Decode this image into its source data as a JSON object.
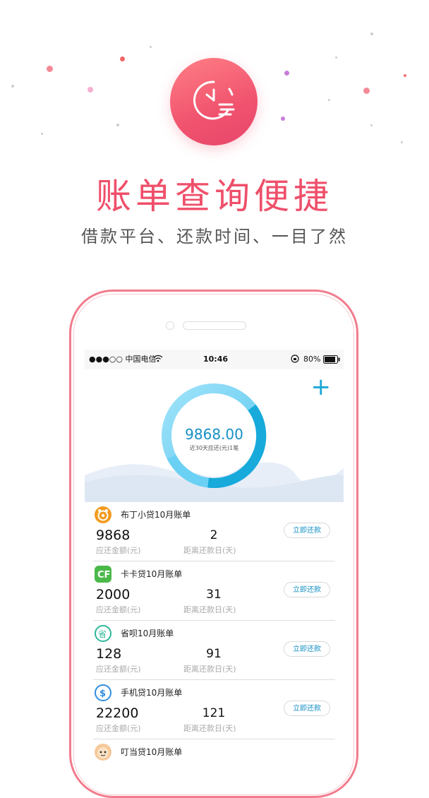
{
  "hero": {
    "headline": "账单查询便捷",
    "subline": "借款平台、还款时间、一目了然"
  },
  "status_bar": {
    "carrier": "●●●○○ 中国电信",
    "time": "10:46",
    "battery": "80%"
  },
  "summary": {
    "add_label": "+",
    "total": "9868.00",
    "caption": "近30天应还(元)1笔"
  },
  "bills": [
    {
      "title": "布丁小贷10月账单",
      "amount": "9868",
      "amount_label": "应还金额(元)",
      "days": "2",
      "days_label": "距离还款日(天)",
      "button": "立即还款"
    },
    {
      "title": "卡卡贷10月账单",
      "amount": "2000",
      "amount_label": "应还金额(元)",
      "days": "31",
      "days_label": "距离还款日(天)",
      "button": "立即还款"
    },
    {
      "title": "省呗10月账单",
      "amount": "128",
      "amount_label": "应还金额(元)",
      "days": "91",
      "days_label": "距离还款日(天)",
      "button": "立即还款"
    },
    {
      "title": "手机贷10月账单",
      "amount": "22200",
      "amount_label": "应还金额(元)",
      "days": "121",
      "days_label": "距离还款日(天)",
      "button": "立即还款"
    },
    {
      "title": "叮当贷10月账单"
    }
  ],
  "colors": {
    "accent_pink": "#ef4f6a",
    "accent_blue": "#1ba6d6",
    "phone_frame": "#f27c8c"
  },
  "icons": [
    "clock-list-icon",
    "wifi-icon",
    "battery-icon",
    "plus-icon",
    "budin-logo-icon",
    "kaka-logo-icon",
    "shengbei-logo-icon",
    "shoujidai-logo-icon",
    "dingdang-logo-icon"
  ]
}
